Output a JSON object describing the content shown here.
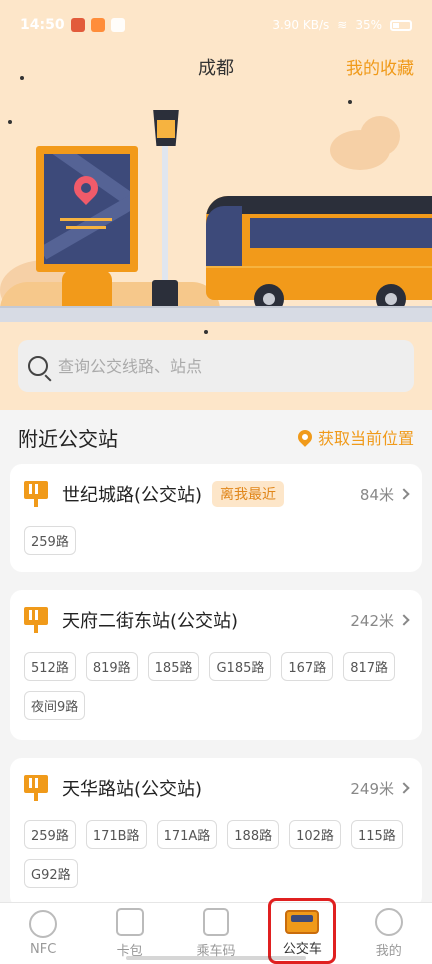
{
  "status_bar": {
    "time": "14:50",
    "network_speed": "3.90 KB/s",
    "battery": "35%"
  },
  "header": {
    "city": "成都",
    "favorites_label": "我的收藏"
  },
  "search": {
    "placeholder": "查询公交线路、站点"
  },
  "nearby": {
    "title": "附近公交站",
    "locate_label": "获取当前位置",
    "stops": [
      {
        "name": "世纪城路(公交站)",
        "badge": "离我最近",
        "distance": "84米",
        "routes": [
          "259路"
        ]
      },
      {
        "name": "天府二街东站(公交站)",
        "distance": "242米",
        "routes": [
          "512路",
          "819路",
          "185路",
          "G185路",
          "167路",
          "817路",
          "夜间9路"
        ]
      },
      {
        "name": "天华路站(公交站)",
        "distance": "249米",
        "routes": [
          "259路",
          "171B路",
          "171A路",
          "188路",
          "102路",
          "115路",
          "G92路"
        ]
      }
    ]
  },
  "bottom_nav": [
    {
      "label": "NFC"
    },
    {
      "label": "卡包"
    },
    {
      "label": "乘车码"
    },
    {
      "label": "公交车"
    },
    {
      "label": "我的"
    }
  ],
  "active_nav": "公交车",
  "colors": {
    "accent": "#f09a1a",
    "hero_bg": "#fde6c9",
    "highlight": "#e02020"
  }
}
